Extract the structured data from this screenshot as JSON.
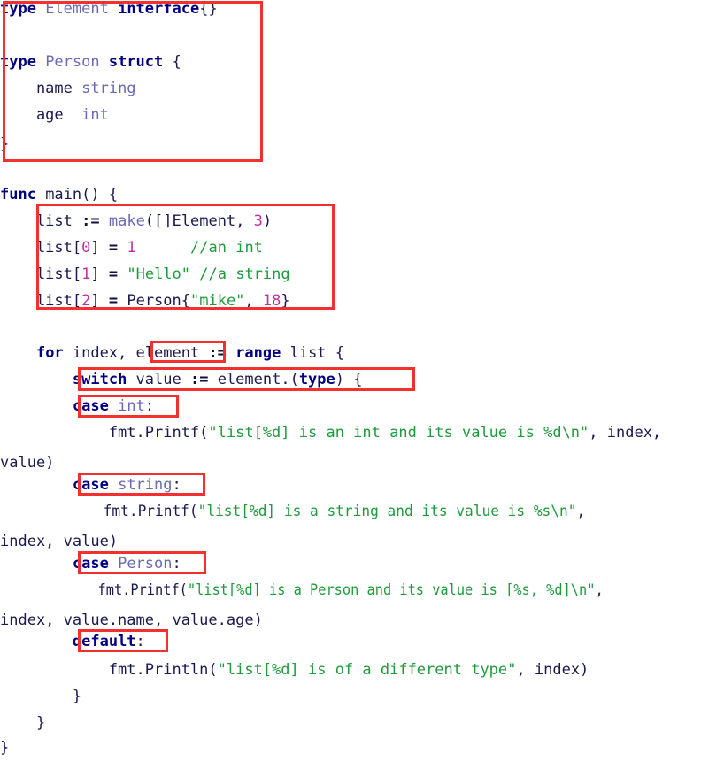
{
  "document": {
    "language": "Go",
    "background_color": "#ffffff",
    "annotation_color": "#f23030"
  },
  "palette": {
    "keyword": "#000080",
    "identifier": "#1a1a4e",
    "type": "#6a6ab4",
    "builtin": "#6a6ab4",
    "number": "#c030a0",
    "string": "#1f9a3c",
    "comment": "#1f9a3c",
    "operator": "#101040"
  },
  "code": {
    "line01": {
      "t1": "type",
      "t2": " Element ",
      "t3": "interface",
      "t4": "{}"
    },
    "line02": {
      "t1": ""
    },
    "line03": {
      "t1": ""
    },
    "line04": {
      "t1": "type",
      "t2": " Person ",
      "t3": "struct",
      "t4": " {"
    },
    "line05": {
      "t1": "    name ",
      "t2": "string"
    },
    "line06": {
      "t1": "    age  ",
      "t2": "int"
    },
    "line07": {
      "t1": ""
    },
    "line08": {
      "t1": "}"
    },
    "line09": {
      "t1": ""
    },
    "line10": {
      "t1": "func",
      "t2": " main() {"
    },
    "line11": {
      "t1": "    list ",
      "t2": ":=",
      "t3": " ",
      "t4": "make",
      "t5": "([]Element, ",
      "t6": "3",
      "t7": ")"
    },
    "line12": {
      "t1": "    list[",
      "t2": "0",
      "t3": "] ",
      "t4": "=",
      "t5": " ",
      "t6": "1",
      "t7": "      ",
      "t8": "//an int"
    },
    "line13": {
      "t1": "    list[",
      "t2": "1",
      "t3": "] ",
      "t4": "=",
      "t5": " ",
      "t6": "\"Hello\"",
      "t7": " ",
      "t8": "//a string"
    },
    "line14": {
      "t1": "    list[",
      "t2": "2",
      "t3": "] ",
      "t4": "=",
      "t5": " Person{",
      "t6": "\"mike\"",
      "t7": ", ",
      "t8": "18",
      "t9": "}"
    },
    "line15": {
      "t1": ""
    },
    "line16": {
      "t1": "    ",
      "t2": "for",
      "t3": " index, element ",
      "t4": ":=",
      "t5": " ",
      "t6": "range",
      "t7": " list {"
    },
    "line17": {
      "t1": "        ",
      "t2": "switch",
      "t3": " value ",
      "t4": ":=",
      "t5": " element.(",
      "t6": "type",
      "t7": ") {"
    },
    "line18": {
      "t1": "        ",
      "t2": "case",
      "t3": " ",
      "t4": "int",
      "t5": ":"
    },
    "line19": {
      "t1": "            fmt.Printf(",
      "t2": "\"list[%d] is an int and its value is %d\\n\"",
      "t3": ", index,"
    },
    "line20": {
      "t1": "value)"
    },
    "line21": {
      "t1": "        ",
      "t2": "case",
      "t3": " ",
      "t4": "string",
      "t5": ":"
    },
    "line22": {
      "t1": "            fmt.Printf(",
      "t2": "\"list[%d] is a string and its value is %s\\n\"",
      "t3": ","
    },
    "line23": {
      "t1": "index, value)"
    },
    "line24": {
      "t1": "        ",
      "t2": "case",
      "t3": " Person",
      "t4": ":"
    },
    "line25": {
      "t1": "            fmt.Printf(",
      "t2": "\"list[%d] is a Person and its value is [%s, %d]\\n\"",
      "t3": ","
    },
    "line26": {
      "t1": "index, value.name, value.age)"
    },
    "line27": {
      "t1": "        ",
      "t2": "default",
      "t3": ":"
    },
    "line28": {
      "t1": "            fmt.Println(",
      "t2": "\"list[%d] is of a different type\"",
      "t3": ", index)"
    },
    "line29": {
      "t1": "        }"
    },
    "line30": {
      "t1": "    }"
    },
    "line31": {
      "t1": "}"
    }
  },
  "annotations": {
    "box_type_declarations": "type-declarations-highlight",
    "box_list_initialization": "list-initialization-highlight",
    "box_element_variable": "element-variable-highlight",
    "box_switch_statement": "switch-type-assertion-highlight",
    "box_case_int": "case-int-highlight",
    "box_case_string": "case-string-highlight",
    "box_case_person": "case-person-highlight",
    "box_default": "default-case-highlight"
  }
}
